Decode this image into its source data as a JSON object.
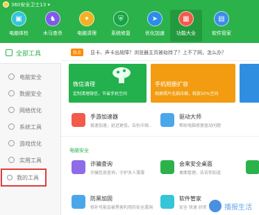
{
  "header": {
    "app_title": "360安全卫士13 ▾",
    "nav": [
      {
        "label": "电脑体检",
        "icon": "pc-check-icon",
        "color": "#35c5d8"
      },
      {
        "label": "木马查杀",
        "icon": "trojan-scan-icon",
        "color": "#7e5ce8"
      },
      {
        "label": "电脑清理",
        "icon": "clean-icon",
        "color": "#f2b024"
      },
      {
        "label": "系统修复",
        "icon": "repair-icon",
        "color": "#15a645"
      },
      {
        "label": "优化加速",
        "icon": "speedup-icon",
        "color": "#2b8de6"
      },
      {
        "label": "功能大全",
        "icon": "all-features-icon",
        "color": "#f25a4a"
      },
      {
        "label": "软件管家",
        "icon": "software-manager-icon",
        "color": "#3a8ee6"
      }
    ]
  },
  "sidebar": {
    "header": "全部工具",
    "items": [
      {
        "label": "电脑安全"
      },
      {
        "label": "数据安全"
      },
      {
        "label": "网络优化"
      },
      {
        "label": "系统工具"
      },
      {
        "label": "游戏优化"
      },
      {
        "label": "实用工具"
      }
    ],
    "my_tools": "我的工具"
  },
  "main": {
    "hot": {
      "badge": "热点",
      "text": "显卡、声卡出故障？浏览器主页被劫持了？上不了网，怎么办？"
    },
    "promos": [
      {
        "title": "微信清理",
        "sub": "定制清理微信，节省手机空间"
      },
      {
        "title": "手机相册扩容",
        "sub": "相册照片无损压缩，释放50%空间"
      },
      {
        "title": "",
        "sub": ""
      }
    ],
    "tools_row1": [
      {
        "name": "手游加速器",
        "desc": "极速加速，延迟更低，告别卡顿..."
      },
      {
        "name": "驱动大师",
        "desc": "帮助电脑修复驱动问题"
      }
    ],
    "section": "电脑安全",
    "tools_row2": [
      {
        "name": "诈骗查询",
        "desc": "诈骗信息查询，守护多人薄薄"
      },
      {
        "name": "会来安全桌面",
        "desc": "桌面管理，告诉你知道"
      }
    ],
    "tools_row3": [
      {
        "name": "防黑加固",
        "desc": "修补可能会被黑客利用的安全漏洞"
      },
      {
        "name": "软件管家",
        "desc": "安全 快速 好用"
      }
    ],
    "watermark": "播报生活"
  }
}
